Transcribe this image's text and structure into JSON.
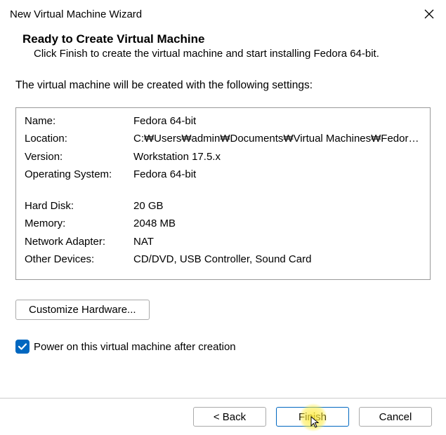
{
  "titlebar": {
    "title": "New Virtual Machine Wizard"
  },
  "header": {
    "title": "Ready to Create Virtual Machine",
    "subtitle": "Click Finish to create the virtual machine and start installing Fedora 64-bit."
  },
  "intro": "The virtual machine will be created with the following settings:",
  "settings": {
    "group1": [
      {
        "label": "Name:",
        "value": "Fedora 64-bit"
      },
      {
        "label": "Location:",
        "value": "C:₩Users₩admin₩Documents₩Virtual Machines₩Fedora ..."
      },
      {
        "label": "Version:",
        "value": "Workstation 17.5.x"
      },
      {
        "label": "Operating System:",
        "value": "Fedora 64-bit"
      }
    ],
    "group2": [
      {
        "label": "Hard Disk:",
        "value": "20 GB"
      },
      {
        "label": "Memory:",
        "value": "2048 MB"
      },
      {
        "label": "Network Adapter:",
        "value": "NAT"
      },
      {
        "label": "Other Devices:",
        "value": "CD/DVD, USB Controller, Sound Card"
      }
    ]
  },
  "customize_label": "Customize Hardware...",
  "power_on_label": "Power on this virtual machine after creation",
  "footer": {
    "back": "< Back",
    "finish": "Finish",
    "cancel": "Cancel"
  }
}
